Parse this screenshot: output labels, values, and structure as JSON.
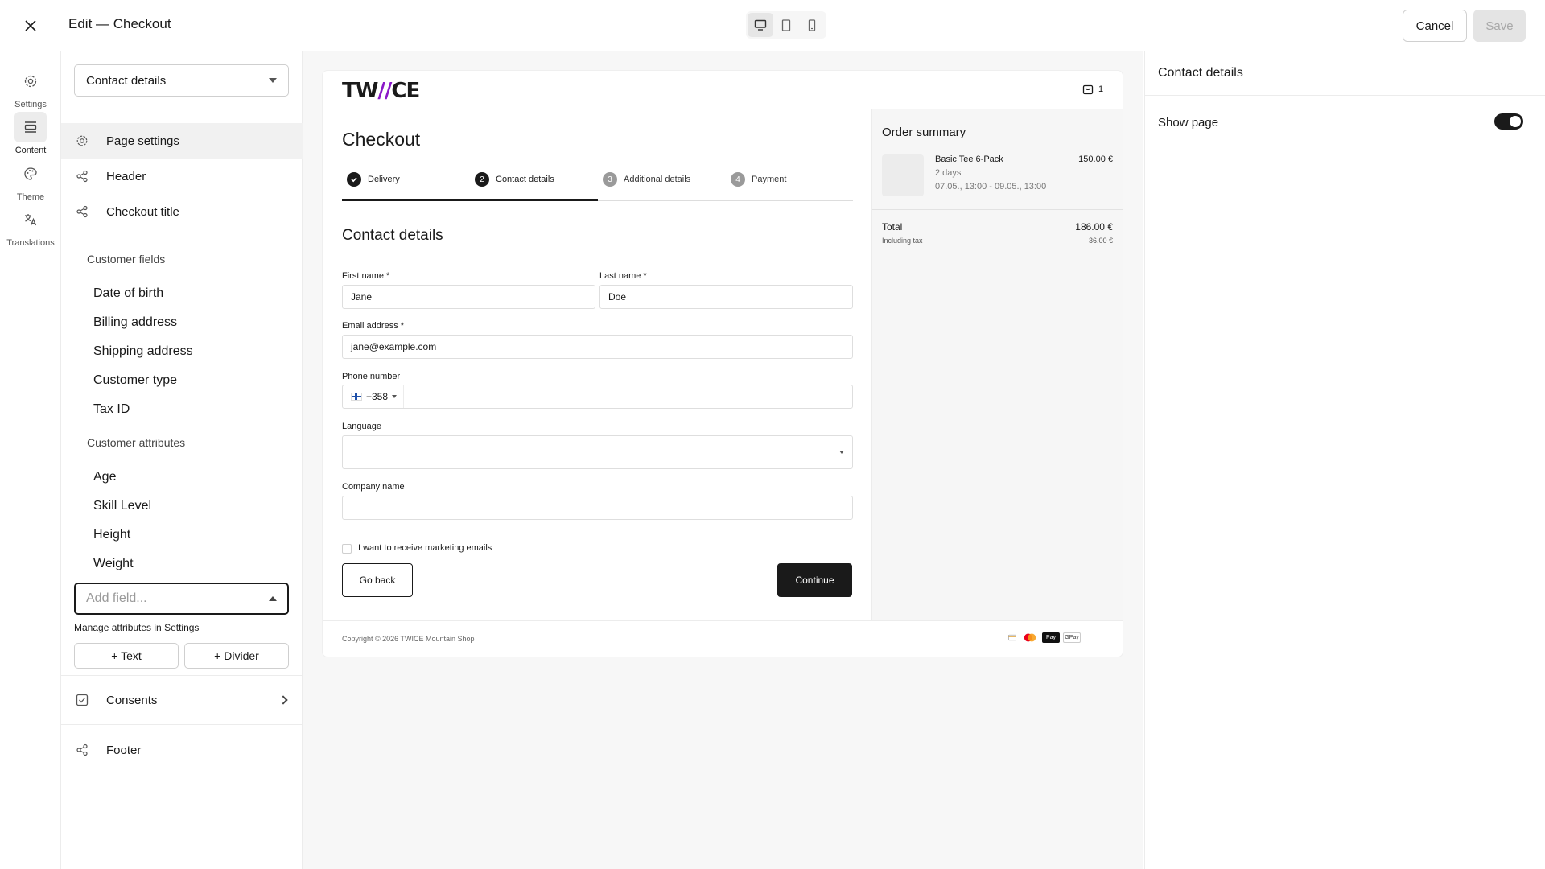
{
  "topbar": {
    "title": "Edit — Checkout",
    "cancel_label": "Cancel",
    "save_label": "Save"
  },
  "rail": {
    "items": [
      {
        "label": "Settings",
        "icon": "gear-icon"
      },
      {
        "label": "Content",
        "icon": "content-icon",
        "active": true
      },
      {
        "label": "Theme",
        "icon": "palette-icon"
      },
      {
        "label": "Translations",
        "icon": "translate-icon"
      }
    ]
  },
  "sidebar": {
    "section_select": "Contact details",
    "nav": {
      "page_settings": "Page settings",
      "header": "Header",
      "checkout_title": "Checkout title",
      "consents": "Consents",
      "footer": "Footer"
    },
    "customer_fields_label": "Customer fields",
    "customer_fields": [
      "Date of birth",
      "Billing address",
      "Shipping address",
      "Customer type",
      "Tax ID"
    ],
    "customer_attributes_label": "Customer attributes",
    "customer_attributes": [
      "Age",
      "Skill Level",
      "Height",
      "Weight"
    ],
    "add_field_placeholder": "Add field...",
    "manage_link": "Manage attributes in Settings",
    "add_text_label": "+ Text",
    "add_divider_label": "+ Divider"
  },
  "preview": {
    "logo_left": "TW",
    "logo_mark": "//",
    "logo_right": "CE",
    "cart_count": "1",
    "checkout_title": "Checkout",
    "steps": [
      {
        "num": "",
        "label": "Delivery",
        "state": "done"
      },
      {
        "num": "2",
        "label": "Contact details",
        "state": "current"
      },
      {
        "num": "3",
        "label": "Additional details",
        "state": "upcoming"
      },
      {
        "num": "4",
        "label": "Payment",
        "state": "upcoming"
      }
    ],
    "step_progress": 0.5,
    "section_title": "Contact details",
    "fields": {
      "first_name_label": "First name *",
      "first_name_value": "Jane",
      "last_name_label": "Last name *",
      "last_name_value": "Doe",
      "email_label": "Email address *",
      "email_value": "jane@example.com",
      "phone_label": "Phone number",
      "phone_prefix": "+358",
      "language_label": "Language",
      "company_label": "Company name"
    },
    "marketing_label": "I want to receive marketing emails",
    "go_back_label": "Go back",
    "continue_label": "Continue",
    "order_summary": {
      "title": "Order summary",
      "product_name": "Basic Tee 6-Pack",
      "product_price": "150.00 €",
      "product_duration": "2 days",
      "product_dates": "07.05., 13:00 - 09.05., 13:00",
      "total_label": "Total",
      "total_value": "186.00 €",
      "tax_label": "Including tax",
      "tax_value": "36.00 €"
    },
    "copyright": "Copyright © 2026 TWICE Mountain Shop",
    "payment_icons": [
      "card-icon",
      "mastercard-icon",
      "apple-pay-icon",
      "google-pay-icon"
    ],
    "payment_labels": {
      "apple": "Pay",
      "google": "GPay"
    }
  },
  "rpanel": {
    "title": "Contact details",
    "show_page_label": "Show page",
    "show_page_on": true
  },
  "colors": {
    "brand_mark": "#8a18c8",
    "primary": "#1a1a1a"
  }
}
